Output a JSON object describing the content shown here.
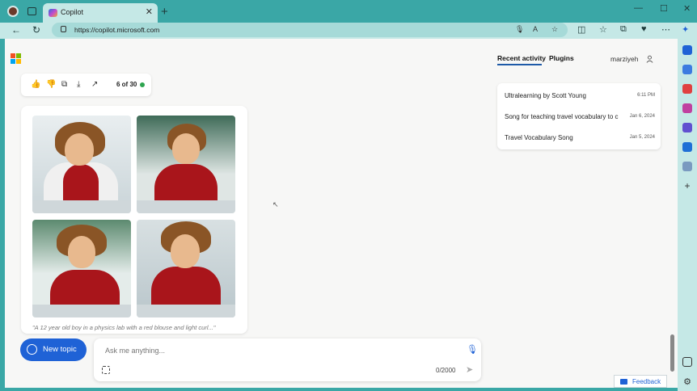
{
  "browser": {
    "tab_title": "Copilot",
    "url": "https://copilot.microsoft.com",
    "icons": [
      "profile-avatar",
      "tab-actions-icon",
      "close-icon",
      "new-tab-icon",
      "back-icon",
      "refresh-icon",
      "lock-icon",
      "mic-icon",
      "read-aloud-icon",
      "favorite-icon",
      "split-screen-icon",
      "favorites-bar-icon",
      "collections-icon",
      "extensions-icon",
      "more-icon",
      "copilot-icon"
    ]
  },
  "header": {
    "tabs": [
      "Recent activity",
      "Plugins"
    ],
    "user": "marziyeh"
  },
  "response_actions": {
    "counter": "6 of 30",
    "status_color": "#2ea44f"
  },
  "image_card": {
    "caption": "\"A 12 year old boy in a physics lab with a red blouse and light curl...\"",
    "image_count": 4
  },
  "recent": [
    {
      "title": "Ultralearning by Scott Young",
      "date": "6:11 PM"
    },
    {
      "title": "Song for teaching travel vocabulary to c",
      "date": "Jan 6, 2024"
    },
    {
      "title": "Travel Vocabulary Song",
      "date": "Jan 5, 2024"
    }
  ],
  "composer": {
    "new_topic": "New topic",
    "placeholder": "Ask me anything...",
    "char_count": "0/2000"
  },
  "feedback": "Feedback",
  "colors": {
    "accent": "#1f62d6",
    "browser_chrome": "#3aa7a6",
    "toolbar": "#c5e8e6"
  }
}
